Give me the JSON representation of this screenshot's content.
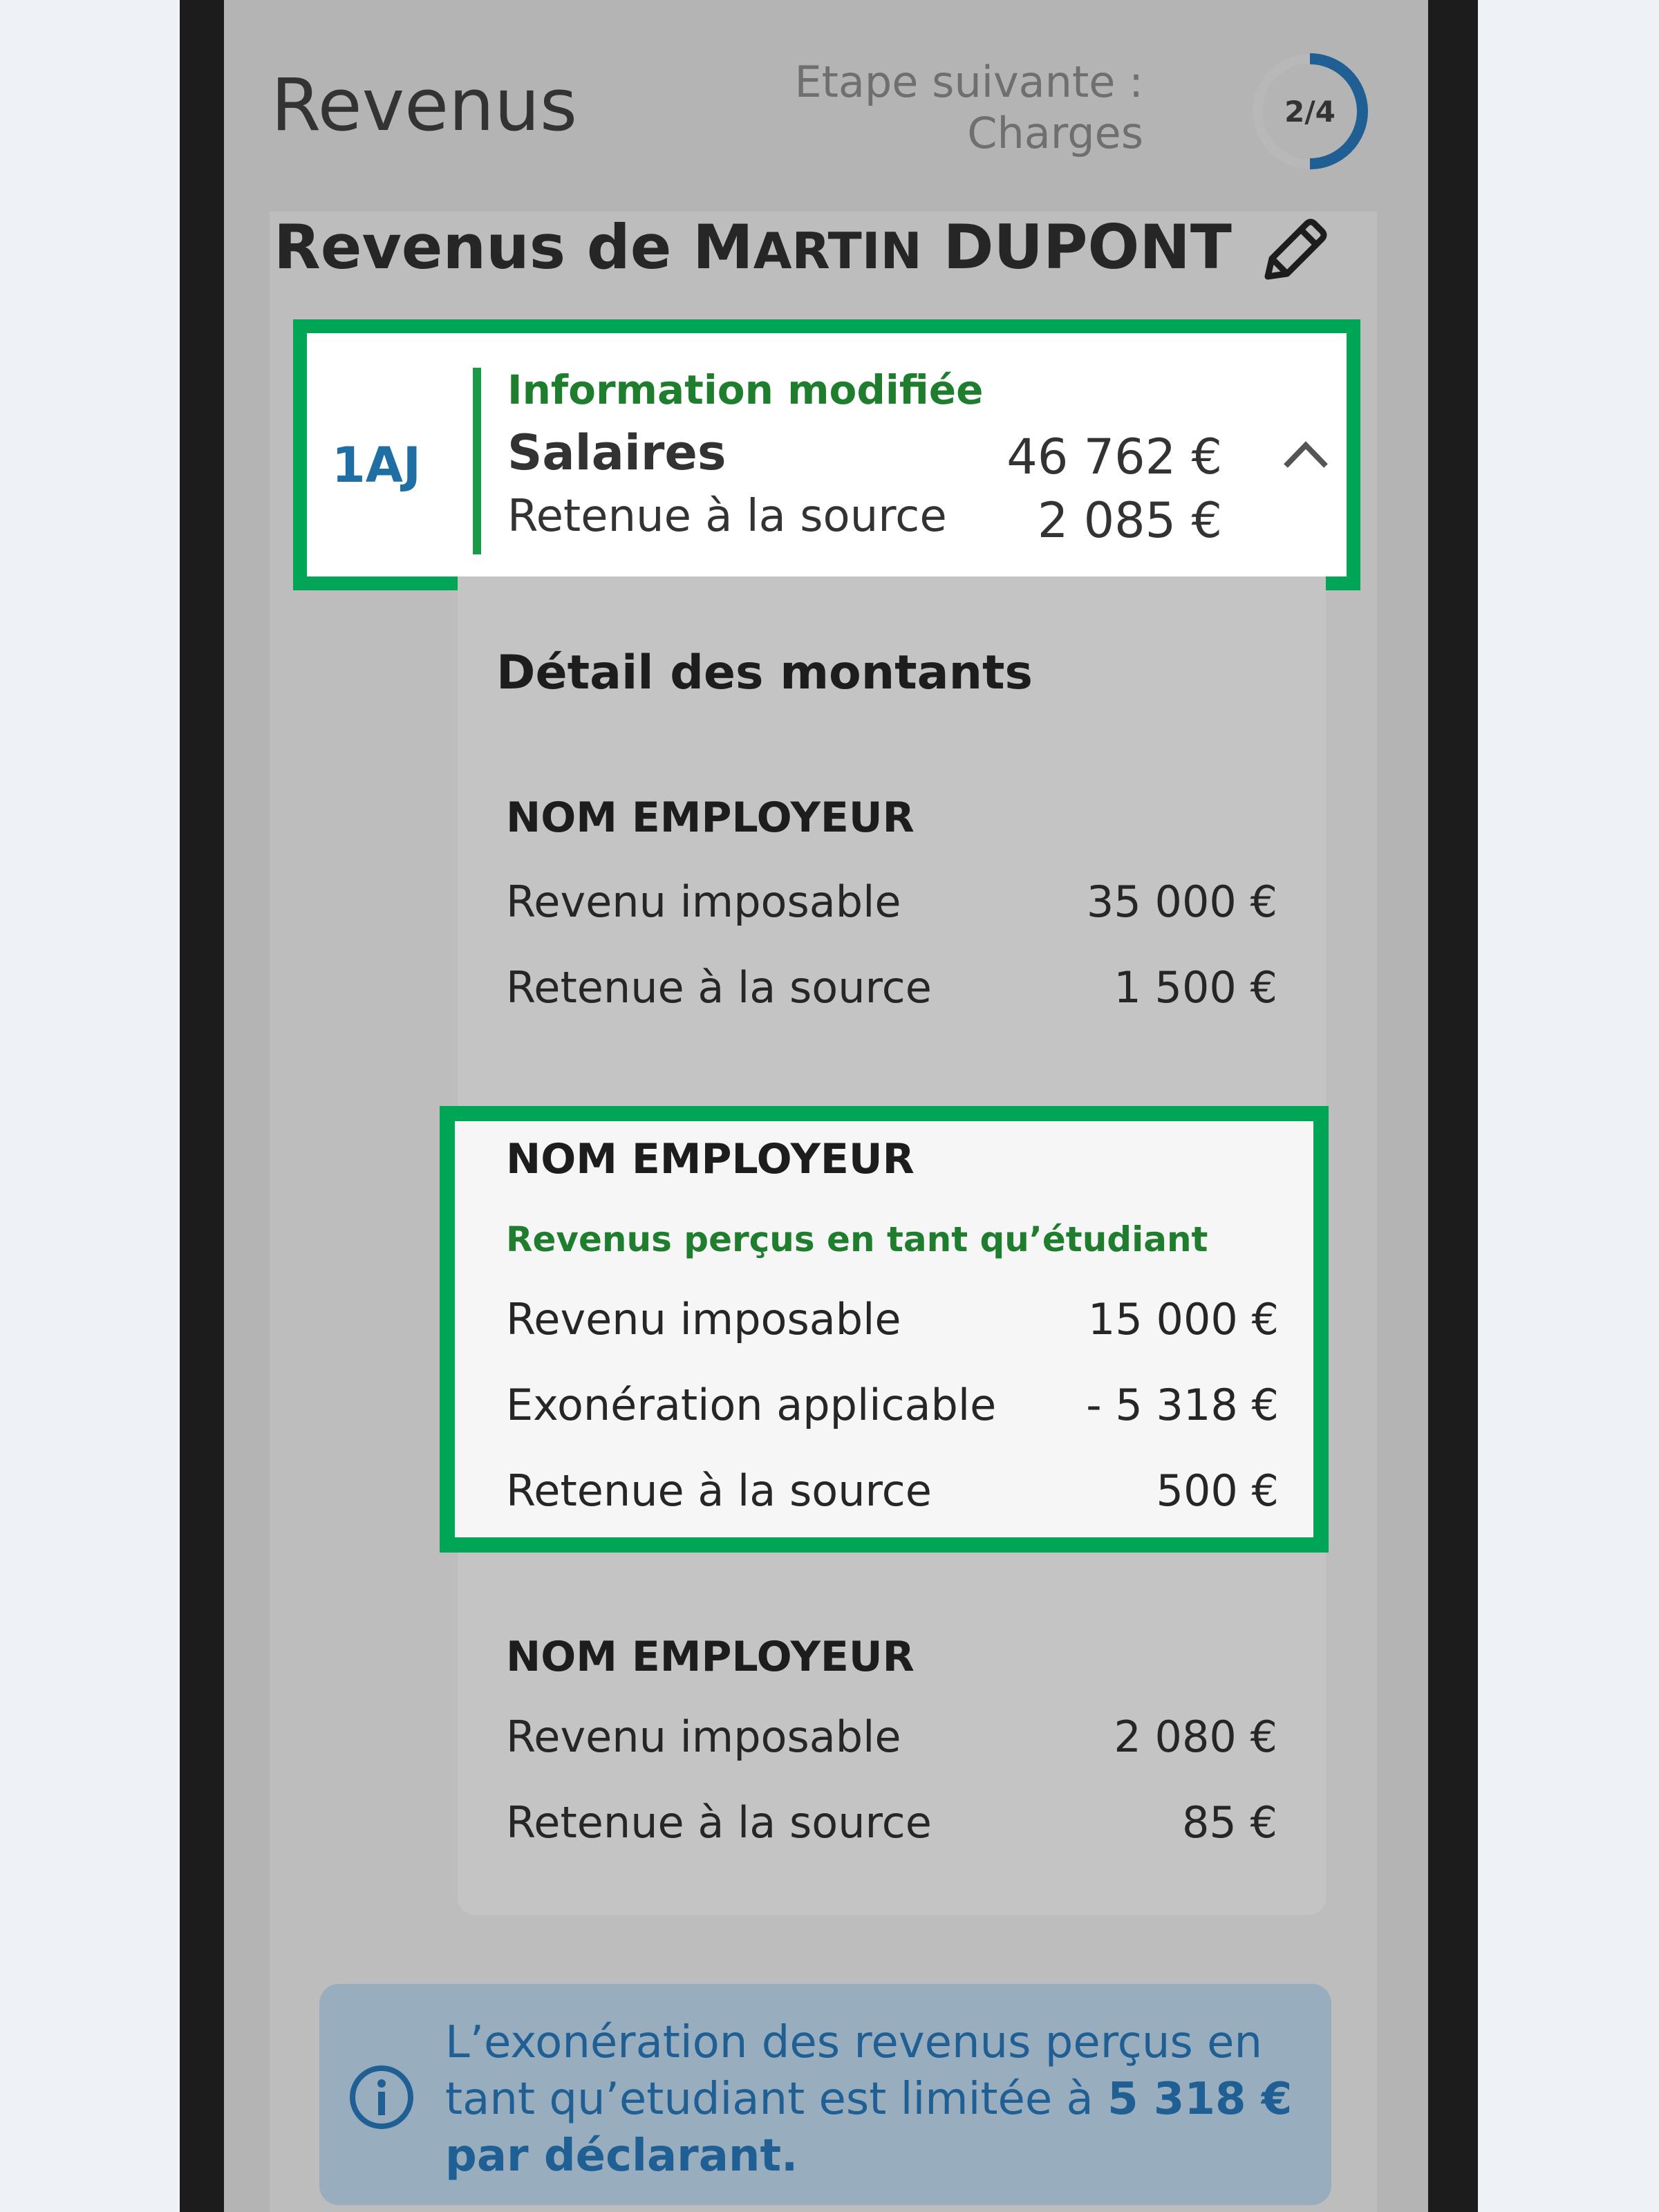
{
  "header": {
    "title": "Revenus",
    "next_step_line1": "Etape suivante :",
    "next_step_line2": "Charges",
    "progress": {
      "label": "2/4",
      "fraction": 0.5,
      "color": "#1f5f93"
    }
  },
  "card": {
    "title_prefix": "Revenus de ",
    "first_name": "MARTIN",
    "last_name": "DUPONT",
    "edit_icon": "pencil-icon"
  },
  "income_row": {
    "code": "1AJ",
    "status": "Information modifiée",
    "label": "Salaires",
    "amount": "46 762 €",
    "withholding_label": "Retenue à la source",
    "withholding_amount": "2 085 €",
    "toggle_icon": "chevron-up-icon"
  },
  "details": {
    "title": "Détail des montants",
    "employers": [
      {
        "name": "NOM EMPLOYEUR",
        "taxable_label": "Revenu imposable",
        "taxable_value": "35 000 €",
        "withholding_label": "Retenue à la source",
        "withholding_value": "1 500 €"
      },
      {
        "name": "NOM EMPLOYEUR",
        "note": "Revenus perçus en tant qu’étudiant",
        "taxable_label": "Revenu imposable",
        "taxable_value": "15 000 €",
        "exemption_label": "Exonération applicable",
        "exemption_value": "- 5 318 €",
        "withholding_label": "Retenue à la source",
        "withholding_value": "500 €"
      },
      {
        "name": "NOM EMPLOYEUR",
        "taxable_label": "Revenu imposable",
        "taxable_value": "2 080 €",
        "withholding_label": "Retenue à la source",
        "withholding_value": "85 €"
      }
    ]
  },
  "info_banner": {
    "icon": "info-icon",
    "text_part1": "L’exonération des revenus perçus en tant qu’etudiant est limitée à ",
    "text_bold1": "5 318 €",
    "text_part2": " ",
    "text_bold2": "par déclarant."
  },
  "colors": {
    "highlight_border": "#00a655",
    "modified_green": "#1f7d2e",
    "code_blue": "#1f6fa4",
    "info_blue": "#1f5f93"
  }
}
